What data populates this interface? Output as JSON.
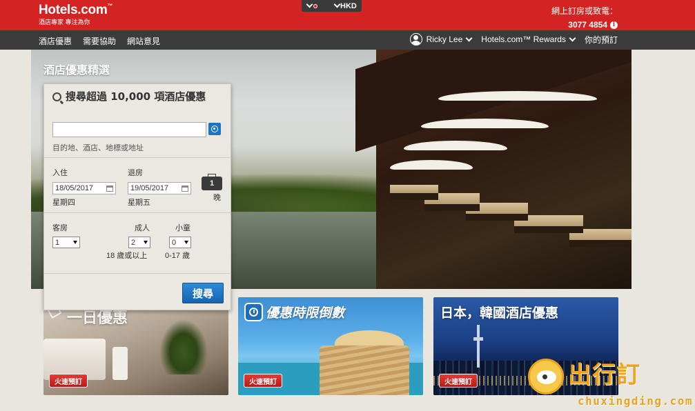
{
  "header": {
    "logo_text": "Hotels.com",
    "logo_tm": "™",
    "logo_tagline": "酒店專家 專注為你",
    "currency": "HKD",
    "phone_label": "網上訂房或致電：",
    "phone_number": "3077 4854"
  },
  "nav": {
    "left_items": [
      "酒店優惠",
      "需要協助",
      "網站意見"
    ],
    "user_name": "Ricky Lee",
    "rewards_label": "Hotels.com™ Rewards",
    "bookings_label": "你的預訂"
  },
  "hero": {
    "title": "酒店優惠精選"
  },
  "search": {
    "heading": "搜尋超過 10,000 項酒店優惠",
    "destination_value": "",
    "destination_hint": "目的地、酒店、地標或地址",
    "checkin_label": "入住",
    "checkin_value": "18/05/2017",
    "checkin_day": "星期四",
    "checkout_label": "退房",
    "checkout_value": "19/05/2017",
    "checkout_day": "星期五",
    "nights_count": "1",
    "nights_label": "晚",
    "rooms_label": "客房",
    "rooms_value": "1",
    "adults_label": "成人",
    "adults_value": "2",
    "adults_note": "18 歲或以上",
    "children_label": "小童",
    "children_value": "0",
    "children_note": "0-17 歲",
    "submit_label": "搜尋"
  },
  "promos": [
    {
      "title": "一日優惠",
      "button": "火速預訂"
    },
    {
      "title": "優惠時限倒數",
      "button": "火速預訂"
    },
    {
      "title": "日本，韓國酒店優惠",
      "button": "火速預訂"
    }
  ],
  "watermark": {
    "brand": "出行訂",
    "url": "chuxingding.com"
  },
  "colors": {
    "brand_red": "#d32323",
    "nav_dark": "#3b3b3b",
    "button_blue": "#1a75c4",
    "promo_button_red": "#d42a26"
  }
}
